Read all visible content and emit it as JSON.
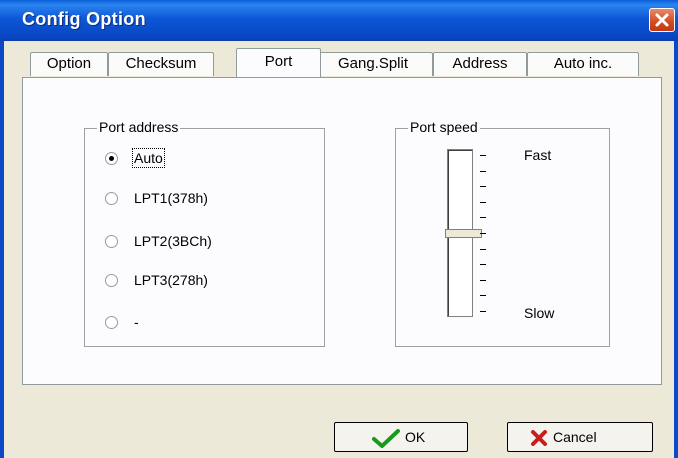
{
  "window": {
    "title": "Config Option"
  },
  "tabs": [
    "Option",
    "Checksum",
    "Port",
    "Gang.Split",
    "Address",
    "Auto inc."
  ],
  "active_tab": "Port",
  "port_address": {
    "label": "Port address",
    "options": [
      "Auto",
      "LPT1(378h)",
      "LPT2(3BCh)",
      "LPT3(278h)",
      "-"
    ],
    "selected": "Auto"
  },
  "port_speed": {
    "label": "Port speed",
    "fast_label": "Fast",
    "slow_label": "Slow",
    "level": 0.5
  },
  "buttons": {
    "ok_label": "OK",
    "cancel_label": "Cancel"
  },
  "colors": {
    "title_bar": "#0a54d6",
    "close": "#d24a22",
    "ok_check": "#1a9a1a",
    "cancel_x": "#c81e1e"
  },
  "icons": {
    "close": "close-icon",
    "ok": "checkmark-icon",
    "cancel": "cross-icon"
  }
}
